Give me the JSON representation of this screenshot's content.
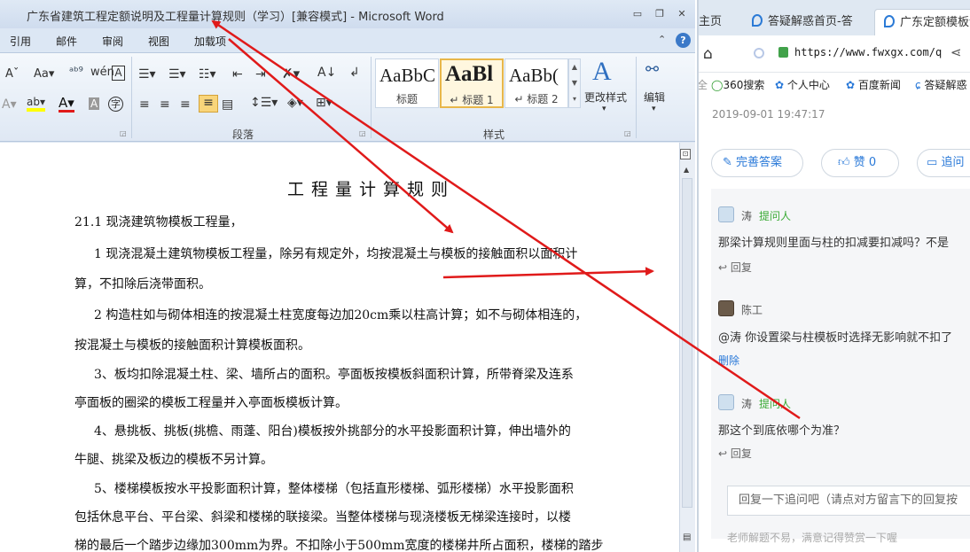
{
  "word": {
    "title": "广东省建筑工程定额说明及工程量计算规则（学习）[兼容模式] - Microsoft Word",
    "window_buttons": {
      "minimize": "▭",
      "restore": "❐",
      "close": "✕"
    },
    "menu": [
      "引用",
      "邮件",
      "审阅",
      "视图",
      "加载项"
    ],
    "ribbon": {
      "font_row1": [
        "A",
        "Aa",
        "wén",
        "A"
      ],
      "paragraph_group_label": "段落",
      "styles_group_label": "样式",
      "styles": [
        {
          "sample": "AaBbC",
          "name": "标题"
        },
        {
          "sample": "AaBl",
          "name": "↵ 标题 1"
        },
        {
          "sample": "AaBb(",
          "name": "↵ 标题 2"
        }
      ],
      "change_styles_label": "更改样式",
      "edit_label": "编辑"
    },
    "document": {
      "heading": "工程量计算规则",
      "paragraphs": [
        "21.1 现浇建筑物模板工程量，",
        "1 现浇混凝土建筑物模板工程量，除另有规定外，均按混凝土与模板的接触面积以面积计",
        "算，不扣除后浇带面积。",
        "2 构造柱如与砌体相连的按混凝土柱宽度每边加20cm乘以柱高计算；如不与砌体相连的，",
        "按混凝土与模板的接触面积计算模板面积。",
        "3、板均扣除混凝土柱、梁、墙所占的面积。亭面板按模板斜面积计算，所带脊梁及连系",
        "亭面板的圈梁的模板工程量并入亭面板模板计算。",
        "4、悬挑板、挑板(挑檐、雨蓬、阳台)模板按外挑部分的水平投影面积计算，伸出墙外的",
        "牛腿、挑梁及板边的模板不另计算。",
        "5、楼梯模板按水平投影面积计算，整体楼梯（包括直形楼梯、弧形楼梯）水平投影面积",
        "包括休息平台、平台梁、斜梁和楼梯的联接梁。当整体楼梯与现浇楼板无梯梁连接时，以楼",
        "梯的最后一个踏步边缘加300mm为界。不扣除小于500mm宽度的楼梯井所占面积，楼梯的踏步"
      ]
    }
  },
  "browser": {
    "tabs": [
      {
        "label": "主页"
      },
      {
        "label": "答疑解惑首页-答"
      },
      {
        "label": "广东定额模板计"
      }
    ],
    "url": "https://www.fwxgx.com/q",
    "bookmarks": [
      "360搜索",
      "个人中心",
      "百度新闻",
      "答疑解惑"
    ],
    "date": "2019-09-01 19:47:17",
    "actions": {
      "improve": "完善答案",
      "like": "赞 0",
      "followup": "追问"
    },
    "thread": [
      {
        "name": "涛",
        "role": "提问人",
        "text": "那梁计算规则里面与柱的扣减要扣减吗？不是",
        "action": "回复"
      },
      {
        "name": "陈工",
        "role": "",
        "text": "@涛 你设置梁与柱模板时选择无影响就不扣了",
        "action": "删除"
      },
      {
        "name": "涛",
        "role": "提问人",
        "text": "那这个到底依哪个为准？",
        "action": "回复"
      }
    ],
    "reply_placeholder": "回复一下追问吧（请点对方留言下的回复按",
    "footnote": "老师解题不易，满意记得赞赏一下喔"
  },
  "colors": {
    "annotation": "#e01a1a",
    "link": "#2878d8",
    "asker": "#3bab36"
  }
}
